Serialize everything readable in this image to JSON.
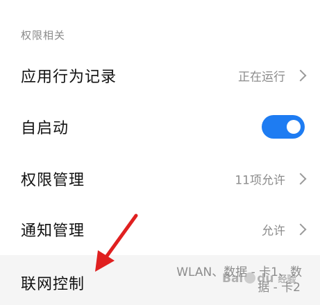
{
  "section": {
    "header": "权限相关"
  },
  "rows": [
    {
      "label": "应用行为记录",
      "value": "正在运行"
    },
    {
      "label": "自启动",
      "toggle_on": true
    },
    {
      "label": "权限管理",
      "value": "11项允许"
    },
    {
      "label": "通知管理",
      "value": "允许"
    },
    {
      "label": "联网控制",
      "value_line1": "WLAN、数据 - 卡1、数",
      "value_line2": "据 - 卡2"
    }
  ],
  "colors": {
    "toggle_on": "#1e7cf2",
    "annotation_arrow": "#e02020"
  },
  "watermark": {
    "text_left": "Bai",
    "text_right": "du",
    "text_sub": "经验"
  }
}
